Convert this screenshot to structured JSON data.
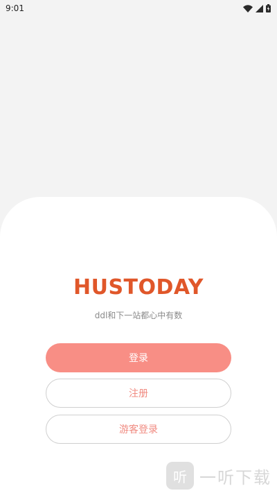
{
  "status_bar": {
    "time": "9:01",
    "icons": [
      "wifi-icon",
      "cellular-signal-icon",
      "battery-charging-icon"
    ]
  },
  "app": {
    "brand_title": "HUSTODAY",
    "tagline": "ddl和下一站都心中有数",
    "brand_color": "#e0572a"
  },
  "actions": {
    "login_label": "登录",
    "register_label": "注册",
    "guest_login_label": "游客登录",
    "primary_color": "#f88e85"
  },
  "watermark": {
    "logo_char": "听",
    "text": "一听下载"
  }
}
